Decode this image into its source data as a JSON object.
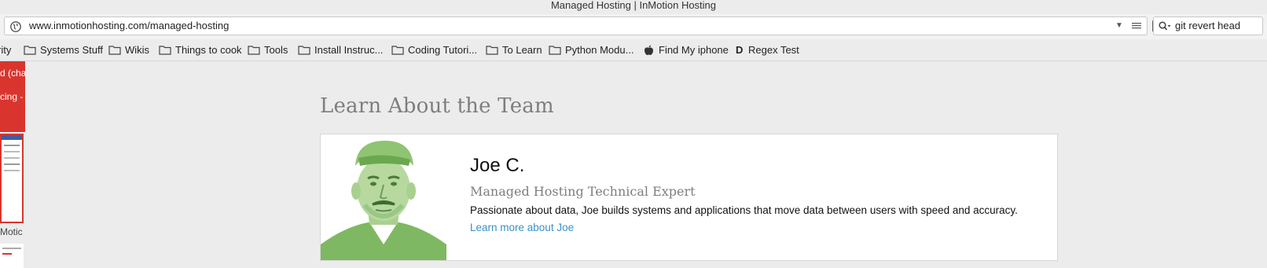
{
  "window": {
    "title": "Managed Hosting | InMotion Hosting"
  },
  "navbar": {
    "url": "www.inmotionhosting.com/managed-hosting",
    "search_query": "git revert head",
    "icons": {
      "site_info": "globe-icon",
      "dropdown": "chevron-down-icon",
      "reader": "reader-mode-icon",
      "bookmark": "bookmark-icon",
      "search": "search-icon"
    }
  },
  "bookmarks": {
    "items": [
      {
        "label": "rity",
        "icon": "none"
      },
      {
        "label": "Systems Stuff",
        "icon": "folder-icon"
      },
      {
        "label": "Wikis",
        "icon": "folder-icon"
      },
      {
        "label": "Things to cook",
        "icon": "folder-icon"
      },
      {
        "label": "Tools",
        "icon": "folder-icon"
      },
      {
        "label": "Install Instruc...",
        "icon": "folder-icon"
      },
      {
        "label": "Coding Tutori...",
        "icon": "folder-icon"
      },
      {
        "label": "To Learn",
        "icon": "folder-icon"
      },
      {
        "label": "Python Modu...",
        "icon": "folder-icon"
      },
      {
        "label": "Find My iphone",
        "icon": "apple-icon"
      },
      {
        "label": "Regex Test",
        "icon": "d-letter-icon"
      }
    ]
  },
  "sidebar": {
    "items": [
      "d (cha",
      "cing -",
      "Motic"
    ]
  },
  "page": {
    "section_title": "Learn About the Team",
    "member": {
      "name": "Joe C.",
      "role": "Managed Hosting Technical Expert",
      "bio": "Passionate about data, Joe builds systems and applications that move data between users with speed and accuracy.",
      "link": "Learn more about Joe"
    },
    "colors": {
      "photo_tint": "#7fb862",
      "link": "#3a8fc7",
      "sidebar_accent": "#d9352e"
    }
  }
}
